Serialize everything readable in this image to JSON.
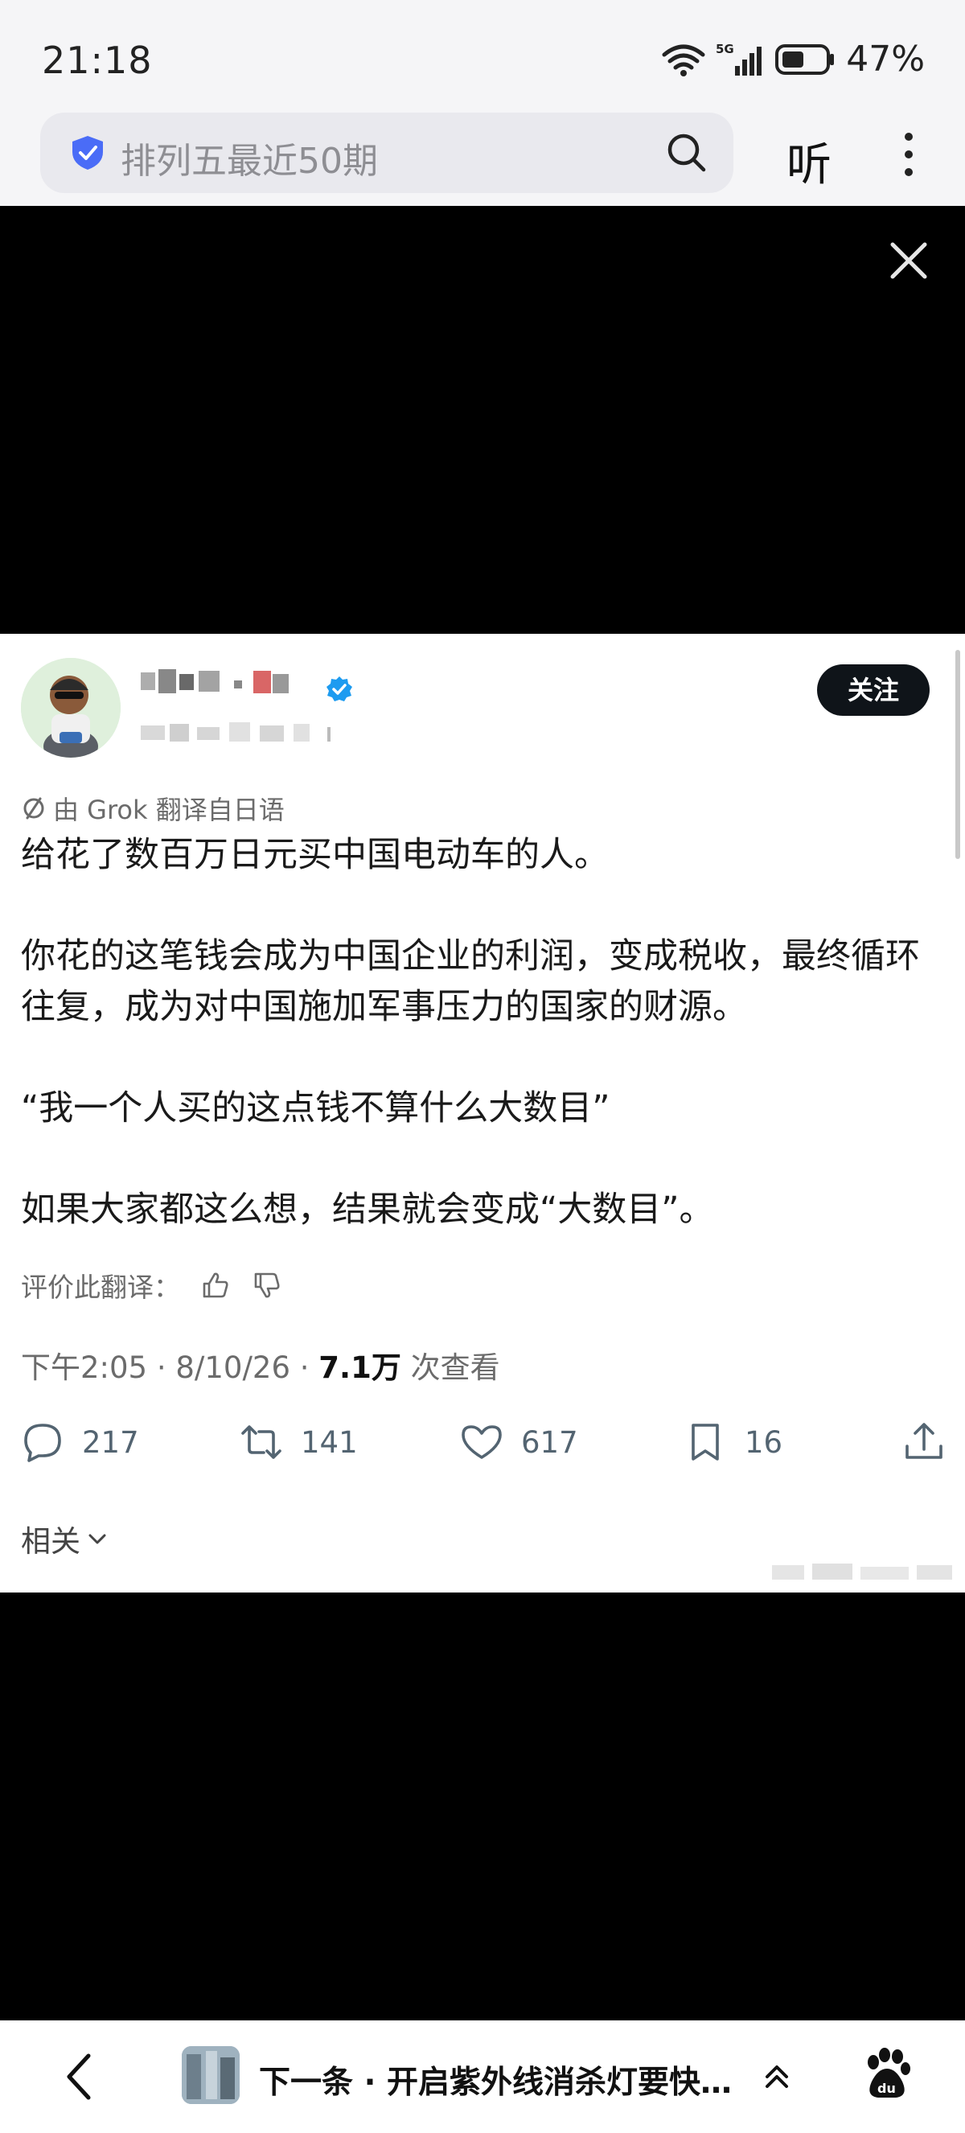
{
  "status_bar": {
    "time": "21:18",
    "network": "5G",
    "battery": "47%"
  },
  "search": {
    "query": "排列五最近50期",
    "listen_label": "听"
  },
  "tweet": {
    "follow_label": "关注",
    "translation_note": "由 Grok 翻译自日语",
    "paragraphs": [
      "给花了数百万日元买中国电动车的人。",
      "你花的这笔钱会成为中国企业的利润，变成税收，最终循环往复，成为对中国施加军事压力的国家的财源。",
      "“我一个人买的这点钱不算什么大数目”",
      "如果大家都这么想，结果就会变成“大数目”。"
    ],
    "rate_label": "评价此翻译：",
    "meta": {
      "time_date": "下午2:05 · 8/10/26 · ",
      "views": "7.1万",
      "views_suffix": " 次查看"
    },
    "actions": {
      "replies": "217",
      "retweets": "141",
      "likes": "617",
      "bookmarks": "16"
    },
    "related_label": "相关"
  },
  "bottom_bar": {
    "next_title": "下一条 · 开启紫外线消杀灯要快…"
  },
  "colors": {
    "verified": "#1d9bf0",
    "shield": "#4a6cf7",
    "follow_bg": "#0f1419"
  }
}
